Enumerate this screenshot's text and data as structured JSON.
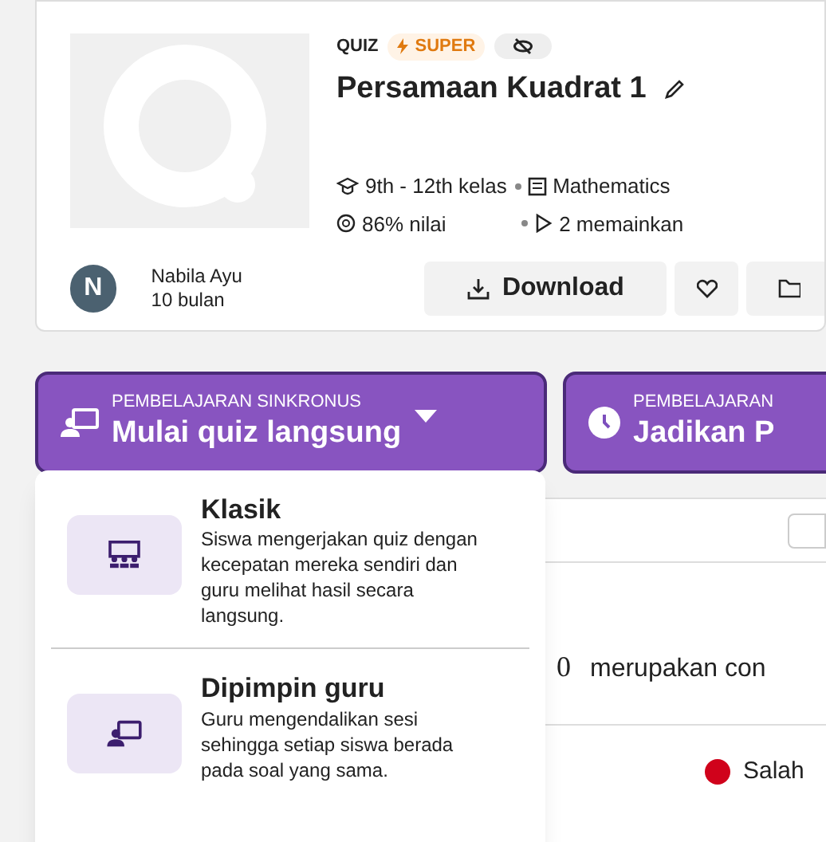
{
  "quiz": {
    "type_label": "QUIZ",
    "badge": "SUPER",
    "title": "Persamaan Kuadrat 1",
    "grade": "9th - 12th kelas",
    "subject": "Mathematics",
    "accuracy": "86% nilai",
    "plays": "2 memainkan"
  },
  "author": {
    "initial": "N",
    "name": "Nabila Ayu",
    "age": "10 bulan"
  },
  "actions": {
    "download": "Download"
  },
  "modes": [
    {
      "caption": "PEMBELAJARAN SINKRONUS",
      "label": "Mulai quiz langsung",
      "kind": "live",
      "expanded": true
    },
    {
      "caption": "PEMBELAJARAN",
      "label": "Jadikan P",
      "kind": "homework",
      "expanded": false
    }
  ],
  "menu": [
    {
      "title": "Klasik",
      "description": "Siswa mengerjakan quiz dengan kecepatan mereka sendiri dan guru melihat hasil secara langsung.",
      "kind": "classic"
    },
    {
      "title": "Dipimpin guru",
      "description": "Guru mengendalikan sesi sehingga setiap siswa berada pada soal yang sama.",
      "kind": "led"
    }
  ],
  "question": {
    "equation": "0",
    "text": "merupakan con",
    "answer": {
      "label": "Salah",
      "color": "#d0021b"
    }
  }
}
